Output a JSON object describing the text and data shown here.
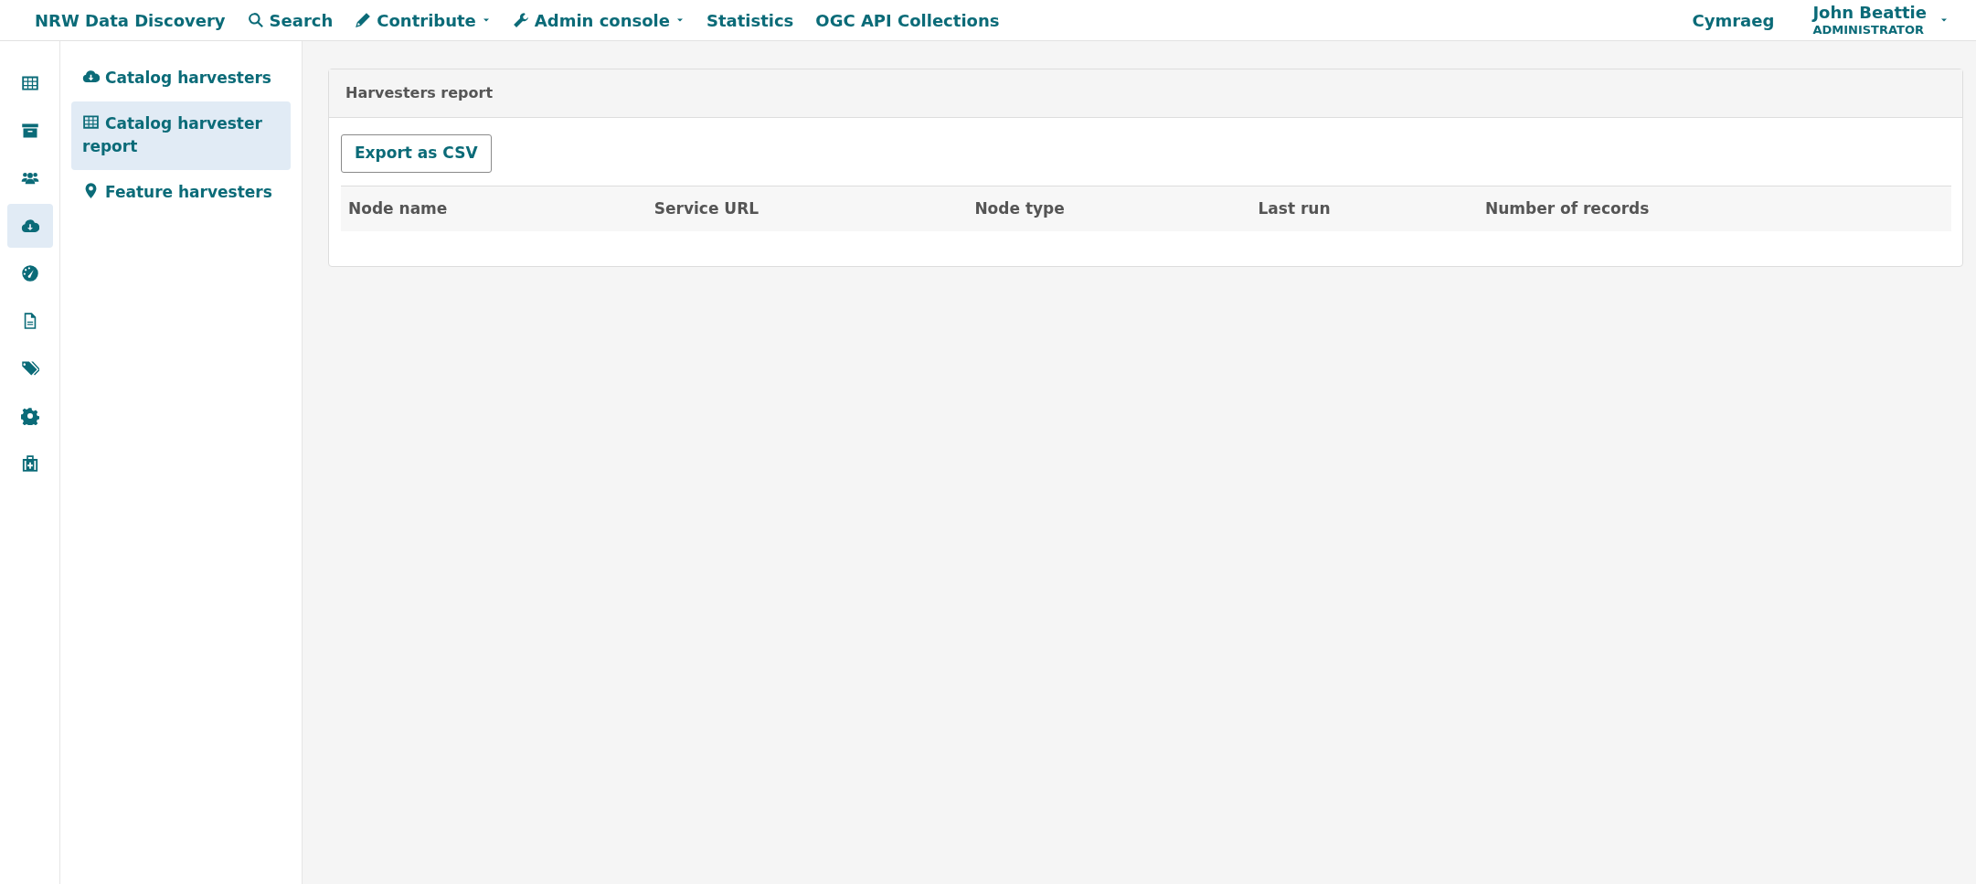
{
  "navbar": {
    "brand": "NRW Data Discovery",
    "items": [
      {
        "label": "Search",
        "dropdown": false
      },
      {
        "label": "Contribute",
        "dropdown": true
      },
      {
        "label": "Admin console",
        "dropdown": true
      },
      {
        "label": "Statistics",
        "dropdown": false
      },
      {
        "label": "OGC API Collections",
        "dropdown": false
      }
    ],
    "language": "Cymraeg",
    "user": {
      "name": "John Beattie",
      "role": "ADMINISTRATOR"
    }
  },
  "icon_rail": [
    {
      "selected": false
    },
    {
      "selected": false
    },
    {
      "selected": false
    },
    {
      "selected": true
    },
    {
      "selected": false
    },
    {
      "selected": false
    },
    {
      "selected": false
    },
    {
      "selected": false
    },
    {
      "selected": false
    }
  ],
  "sidebar": {
    "items": [
      {
        "label": "Catalog harvesters",
        "selected": false
      },
      {
        "label": "Catalog harvester report",
        "selected": true
      },
      {
        "label": "Feature harvesters",
        "selected": false
      }
    ]
  },
  "panel": {
    "title": "Harvesters report",
    "button": "Export as CSV",
    "table": {
      "columns": [
        "Node name",
        "Service URL",
        "Node type",
        "Last run",
        "Number of records"
      ]
    }
  }
}
